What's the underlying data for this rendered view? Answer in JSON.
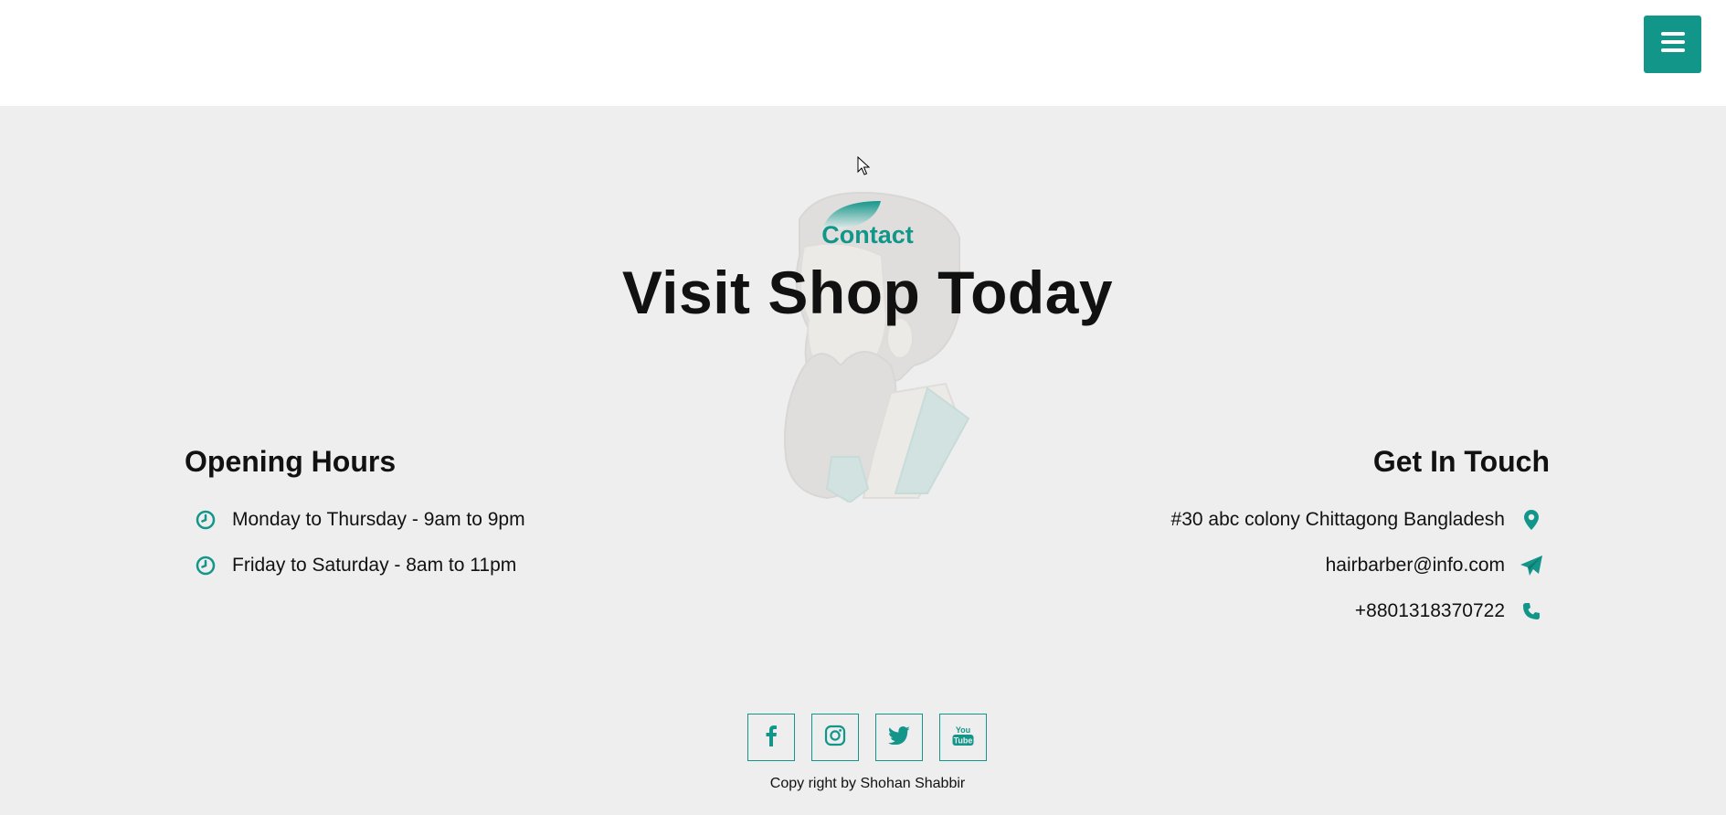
{
  "header": {
    "menu_icon": "hamburger-icon"
  },
  "contact": {
    "eyebrow": "Contact",
    "headline": "Visit Shop Today"
  },
  "opening_hours": {
    "title": "Opening Hours",
    "items": [
      {
        "icon": "clock-icon",
        "text": "Monday to Thursday - 9am to 9pm"
      },
      {
        "icon": "clock-icon",
        "text": "Friday to Saturday - 8am to 11pm"
      }
    ]
  },
  "get_in_touch": {
    "title": "Get In Touch",
    "items": [
      {
        "icon": "map-marker-icon",
        "text": "#30 abc colony Chittagong Bangladesh"
      },
      {
        "icon": "paper-plane-icon",
        "text": "hairbarber@info.com"
      },
      {
        "icon": "phone-icon",
        "text": "+8801318370722"
      }
    ]
  },
  "social": [
    {
      "icon": "facebook-icon"
    },
    {
      "icon": "instagram-icon"
    },
    {
      "icon": "twitter-icon"
    },
    {
      "icon": "youtube-icon"
    }
  ],
  "footer": {
    "copyright": "Copy right by Shohan Shabbir"
  },
  "colors": {
    "accent": "#13968a",
    "background": "#eeeeee",
    "text": "#111111"
  }
}
